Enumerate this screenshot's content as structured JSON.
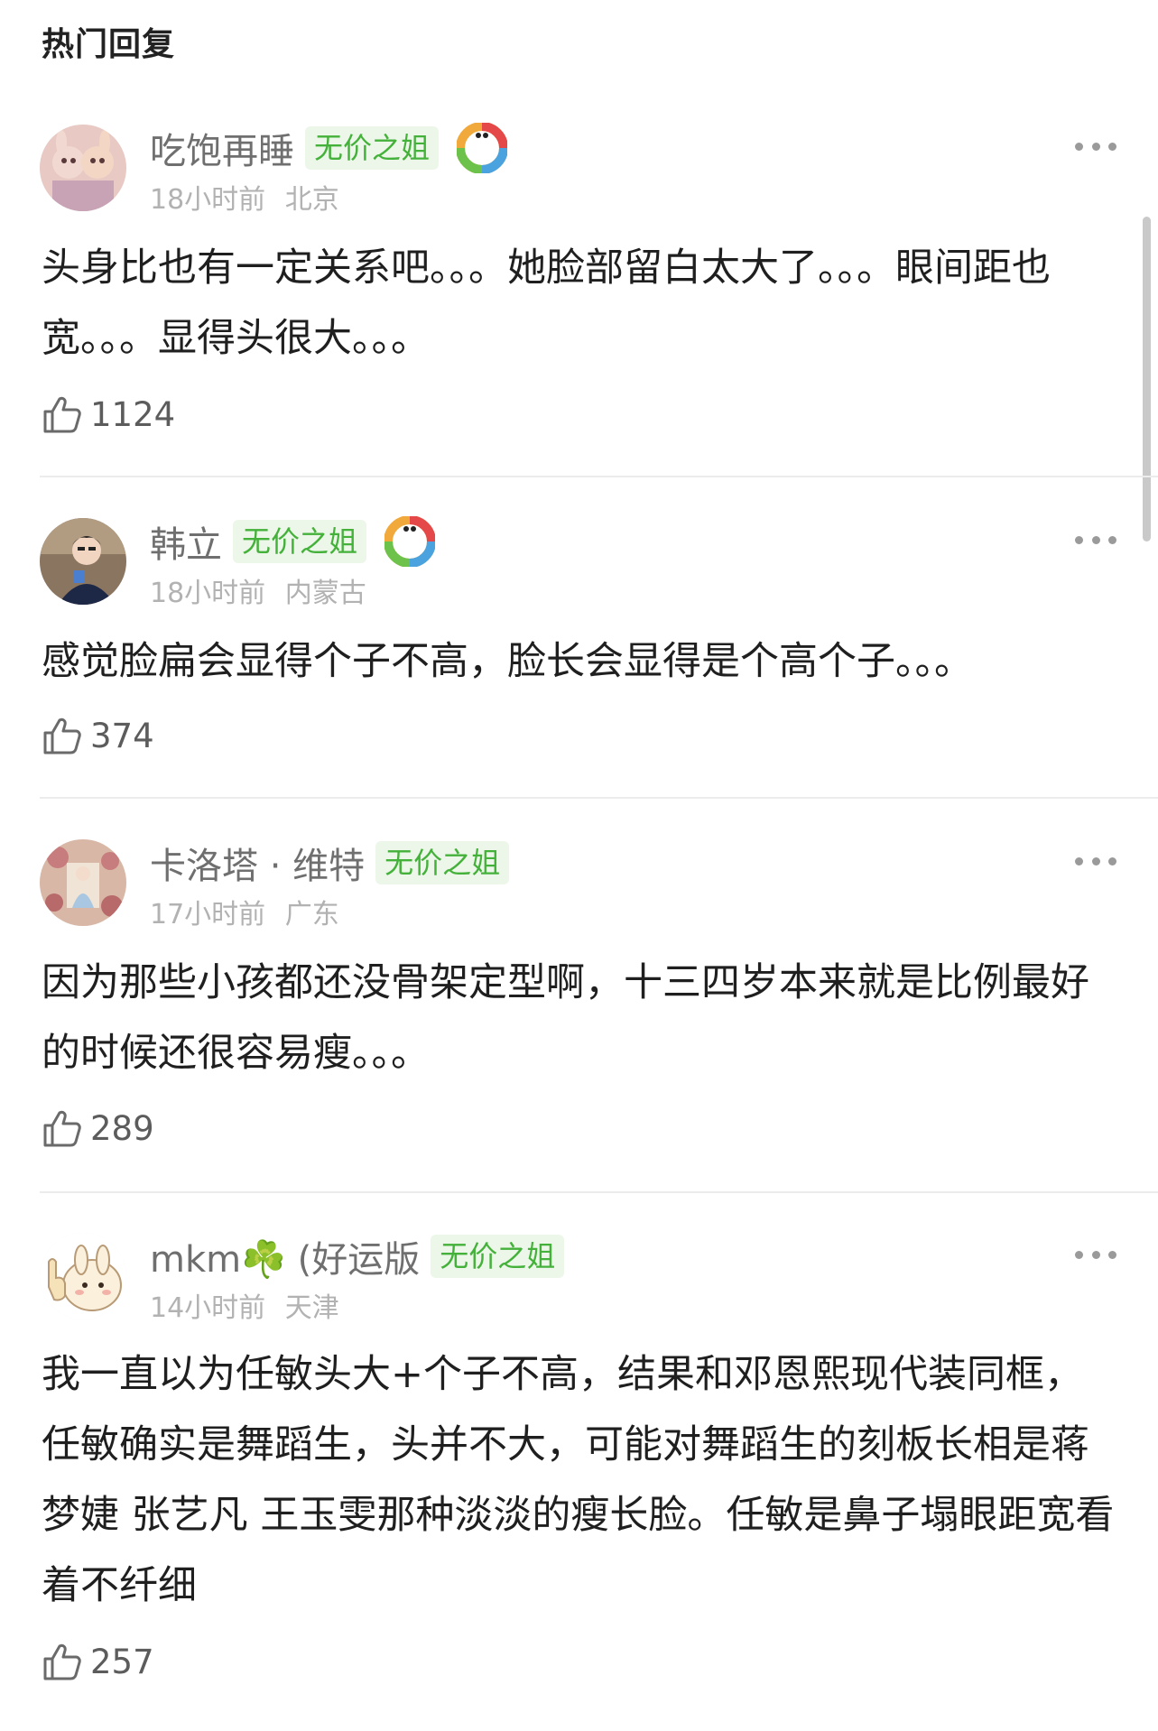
{
  "section_title": "热门回复",
  "comments": [
    {
      "username": "吃饱再睡",
      "badge": "无价之姐",
      "time": "18小时前",
      "location": "北京",
      "text": "头身比也有一定关系吧。。。她脸部留白太大了。。。眼间距也宽。。。显得头很大。。。",
      "likes": "1124"
    },
    {
      "username": "韩立",
      "badge": "无价之姐",
      "time": "18小时前",
      "location": "内蒙古",
      "text": "感觉脸扁会显得个子不高，脸长会显得是个高个子。。。",
      "likes": "374"
    },
    {
      "username": "卡洛塔 · 维特",
      "badge": "无价之姐",
      "time": "17小时前",
      "location": "广东",
      "text": "因为那些小孩都还没骨架定型啊，十三四岁本来就是比例最好的时候还很容易瘦。。。",
      "likes": "289"
    },
    {
      "username": "mkm☘️ (好运版",
      "badge": "无价之姐",
      "time": "14小时前",
      "location": "天津",
      "text": "我一直以为任敏头大+个子不高，结果和邓恩熙现代装同框，任敏确实是舞蹈生，头并不大，可能对舞蹈生的刻板长相是蒋梦婕 张艺凡 王玉雯那种淡淡的瘦长脸。任敏是鼻子塌眼距宽看着不纤细",
      "likes": "257"
    }
  ],
  "colors": {
    "badge_text": "#44b13a",
    "badge_bg": "#edf7e9",
    "username": "#6f6f6f",
    "meta": "#b2b2b2"
  }
}
